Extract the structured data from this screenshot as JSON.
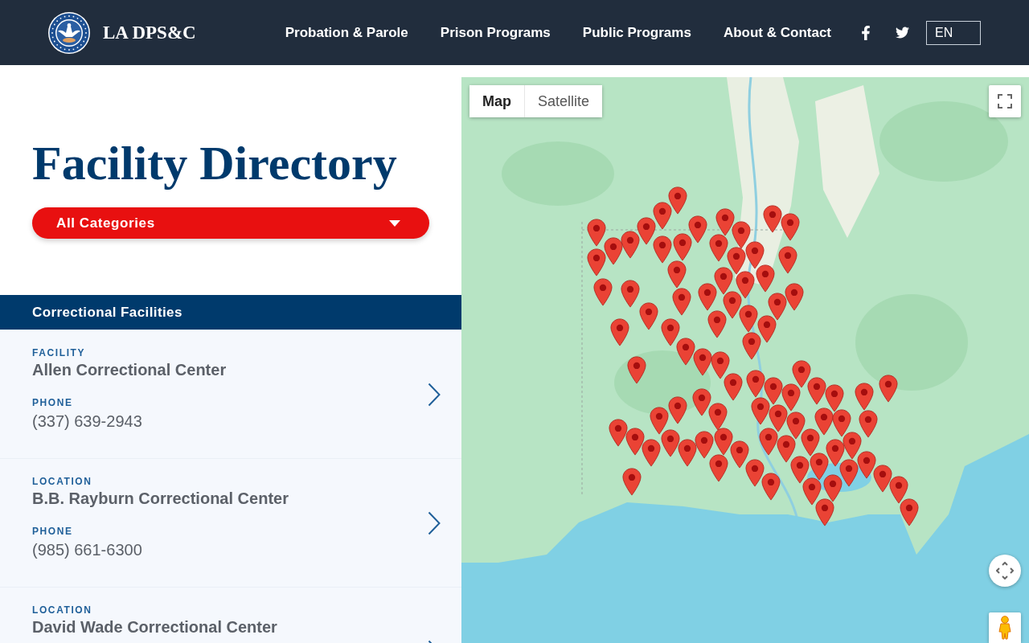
{
  "header": {
    "site_name": "LA DPS&C",
    "nav_links": [
      "Probation & Parole",
      "Prison Programs",
      "Public Programs",
      "About & Contact"
    ],
    "language": "EN"
  },
  "intro": {
    "title": "Facility Directory",
    "category_filter": "All Categories"
  },
  "directory": {
    "section_title": "Correctional Facilities",
    "facilities": [
      {
        "name_label": "FACILITY",
        "name": "Allen Correctional Center",
        "phone_label": "PHONE",
        "phone": "(337) 639-2943"
      },
      {
        "name_label": "LOCATION",
        "name": "B.B. Rayburn Correctional Center",
        "phone_label": "PHONE",
        "phone": "(985) 661-6300"
      },
      {
        "name_label": "LOCATION",
        "name": "David Wade Correctional Center"
      }
    ]
  },
  "map": {
    "view_tabs": [
      {
        "label": "Map",
        "selected": true
      },
      {
        "label": "Satellite",
        "selected": false
      }
    ]
  }
}
